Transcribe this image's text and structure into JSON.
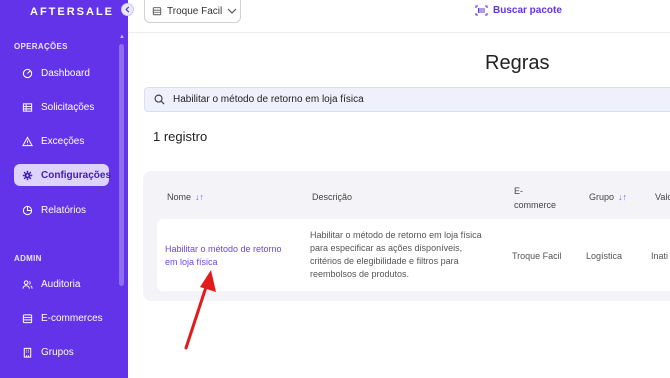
{
  "sidebar": {
    "brand": "AFTERSALE",
    "sections": [
      {
        "title": "OPERAÇÕES"
      },
      {
        "title": "ADMIN"
      }
    ],
    "items": [
      {
        "label": "Dashboard",
        "icon": "dashboard-icon"
      },
      {
        "label": "Solicitações",
        "icon": "table-icon"
      },
      {
        "label": "Exceções",
        "icon": "warning-icon"
      },
      {
        "label": "Configurações",
        "icon": "gear-icon",
        "active": true
      },
      {
        "label": "Relatórios",
        "icon": "chart-icon"
      },
      {
        "label": "Auditoria",
        "icon": "users-icon"
      },
      {
        "label": "E-commerces",
        "icon": "store-icon"
      },
      {
        "label": "Grupos",
        "icon": "building-icon"
      }
    ]
  },
  "header": {
    "store_select": "Troque Facil",
    "buscar_label": "Buscar pacote"
  },
  "main": {
    "title": "Regras",
    "search_value": "Habilitar o método de retorno em loja física",
    "count": "1 registro",
    "table": {
      "columns": [
        "Nome",
        "Descrição",
        "E-\ncommerce",
        "Grupo",
        "Valo"
      ],
      "rows": [
        {
          "nome_line1": "Habilitar o método de retorno",
          "nome_line2": "em loja física",
          "descricao_lines": [
            "Habilitar o método de retorno em loja física",
            "para especificar as ações disponíveis,",
            "critérios de elegibilidade e filtros para",
            "reembolsos de produtos."
          ],
          "ecommerce": "Troque Facil",
          "grupo": "Logística",
          "valor": "Inati"
        }
      ]
    }
  },
  "colors": {
    "sidebar_bg": "#6233e8",
    "accent": "#6233e8",
    "annotation_arrow": "#e21c1c"
  }
}
